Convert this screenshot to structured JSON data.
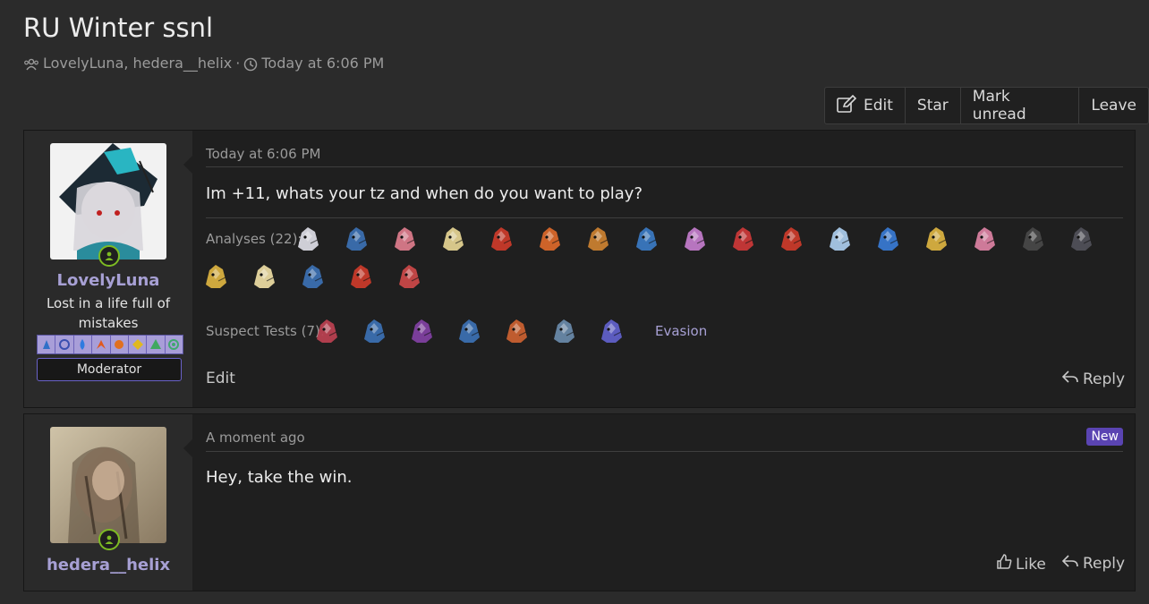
{
  "thread": {
    "title": "RU Winter ssnl",
    "participants": "LovelyLuna, hedera__helix",
    "separator": "·",
    "time": "Today at 6:06 PM"
  },
  "toolbar": {
    "edit": "Edit",
    "star": "Star",
    "mark_unread": "Mark unread",
    "leave": "Leave"
  },
  "posts": [
    {
      "username": "LovelyLuna",
      "user_title": "Lost in a life full of mistakes",
      "banner": "Moderator",
      "date": "Today at 6:06 PM",
      "body": "Im +11, whats your tz and when do you want to play?",
      "signature": {
        "analyses_label": "Analyses (22):",
        "suspect_label": "Suspect Tests (7):",
        "suspect_extra": "Evasion",
        "analyses_colors": [
          "#d8d8e0",
          "#3b6fb0",
          "#d97a8a",
          "#e0d090",
          "#c83a2a",
          "#d8672a",
          "#c88030",
          "#3a78c0",
          "#c07ac8",
          "#c83838",
          "#c83a2a",
          "#a8c8e8",
          "#3878d0",
          "#d8b040",
          "#d880a0",
          "#484848",
          "#505058",
          "#d8b040",
          "#e8d8a0",
          "#3b6fb0",
          "#c83a2a",
          "#c84848"
        ],
        "suspect_colors": [
          "#b84050",
          "#3b6fb0",
          "#8040a0",
          "#3b6fb0",
          "#c86030",
          "#6888a8",
          "#6060c8"
        ]
      },
      "actions": {
        "left": "Edit",
        "reply": "Reply"
      }
    },
    {
      "username": "hedera__helix",
      "date": "A moment ago",
      "new_badge": "New",
      "body": "Hey, take the win.",
      "actions": {
        "like": "Like",
        "reply": "Reply"
      }
    }
  ],
  "colors": {
    "accent": "#a7a0d4",
    "online": "#7dbb23",
    "new_badge": "#5a44b2"
  }
}
